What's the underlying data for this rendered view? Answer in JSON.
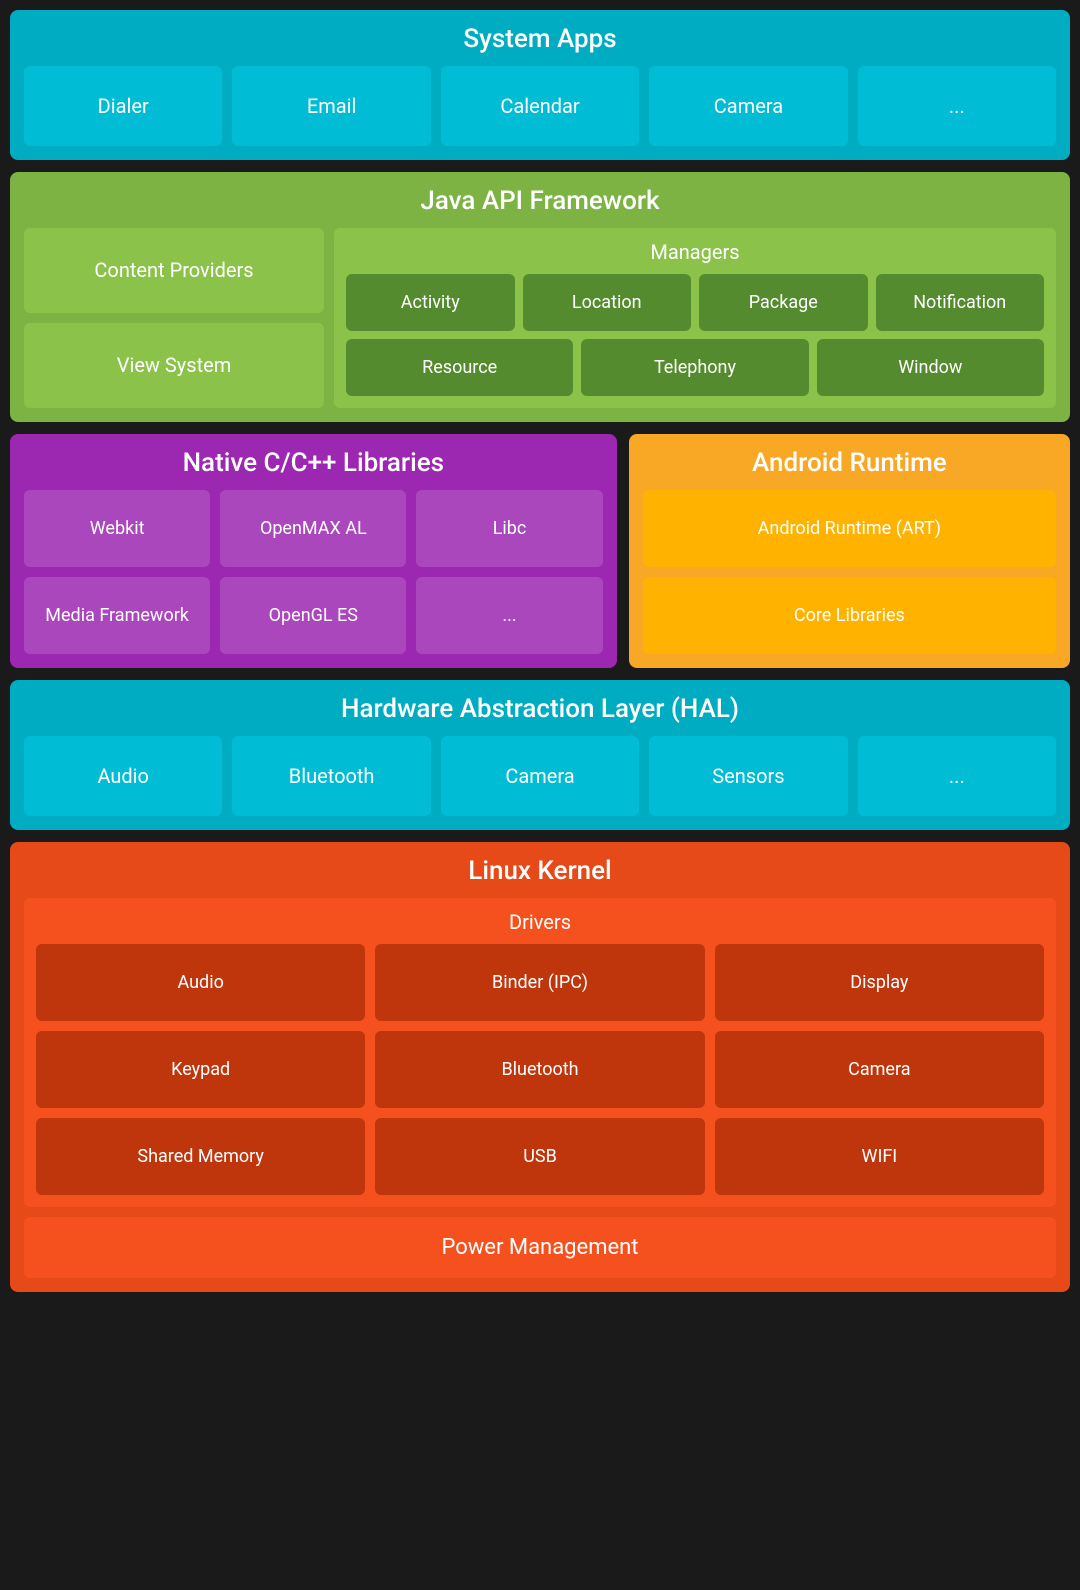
{
  "system_apps": {
    "title": "System Apps",
    "apps": [
      "Dialer",
      "Email",
      "Calendar",
      "Camera",
      "..."
    ]
  },
  "java_api": {
    "title": "Java API Framework",
    "left_items": [
      "Content Providers",
      "View System"
    ],
    "managers_title": "Managers",
    "managers_row1": [
      "Activity",
      "Location",
      "Package",
      "Notification"
    ],
    "managers_row2": [
      "Resource",
      "Telephony",
      "Window"
    ]
  },
  "native_cpp": {
    "title": "Native C/C++ Libraries",
    "items": [
      "Webkit",
      "OpenMAX AL",
      "Libc",
      "Media Framework",
      "OpenGL ES",
      "..."
    ]
  },
  "android_runtime": {
    "title": "Android Runtime",
    "items": [
      "Android Runtime (ART)",
      "Core Libraries"
    ]
  },
  "hal": {
    "title": "Hardware Abstraction Layer (HAL)",
    "items": [
      "Audio",
      "Bluetooth",
      "Camera",
      "Sensors",
      "..."
    ]
  },
  "linux_kernel": {
    "title": "Linux Kernel",
    "drivers_title": "Drivers",
    "drivers": [
      "Audio",
      "Binder (IPC)",
      "Display",
      "Keypad",
      "Bluetooth",
      "Camera",
      "Shared Memory",
      "USB",
      "WIFI"
    ],
    "power_management": "Power Management"
  }
}
